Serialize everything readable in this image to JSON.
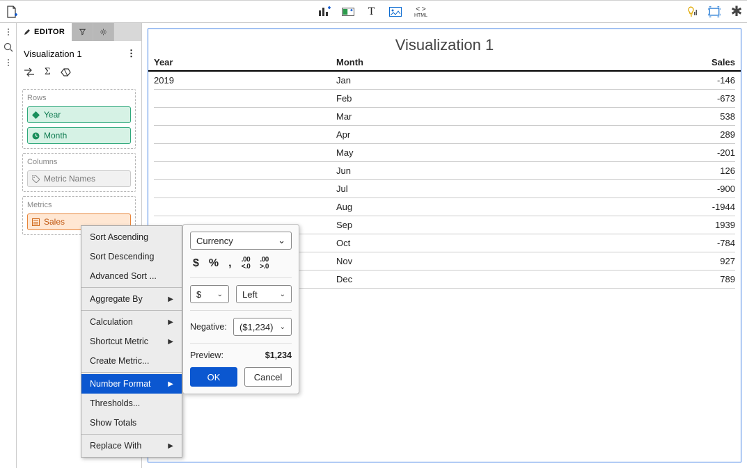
{
  "toolbar": {
    "new_page_icon": "new-page",
    "chart_add_icon": "chart-add",
    "container_icon": "container",
    "text_icon": "T",
    "image_icon": "image",
    "html_label": "HTML",
    "insight_icon": "lightbulb",
    "layout_icon": "layout"
  },
  "editor": {
    "tab_label": "EDITOR",
    "viz_name": "Visualization 1",
    "rows_label": "Rows",
    "columns_label": "Columns",
    "metrics_label": "Metrics",
    "pills": {
      "year": "Year",
      "month": "Month",
      "metric_names": "Metric Names",
      "sales": "Sales"
    }
  },
  "viz": {
    "title": "Visualization 1",
    "headers": {
      "year": "Year",
      "month": "Month",
      "sales": "Sales"
    },
    "rows": [
      {
        "year": "2019",
        "month": "Jan",
        "sales": "-146"
      },
      {
        "year": "",
        "month": "Feb",
        "sales": "-673"
      },
      {
        "year": "",
        "month": "Mar",
        "sales": "538"
      },
      {
        "year": "",
        "month": "Apr",
        "sales": "289"
      },
      {
        "year": "",
        "month": "May",
        "sales": "-201"
      },
      {
        "year": "",
        "month": "Jun",
        "sales": "126"
      },
      {
        "year": "",
        "month": "Jul",
        "sales": "-900"
      },
      {
        "year": "",
        "month": "Aug",
        "sales": "-1944"
      },
      {
        "year": "",
        "month": "Sep",
        "sales": "1939"
      },
      {
        "year": "",
        "month": "Oct",
        "sales": "-784"
      },
      {
        "year": "",
        "month": "Nov",
        "sales": "927"
      },
      {
        "year": "",
        "month": "Dec",
        "sales": "789"
      }
    ]
  },
  "ctx": {
    "sort_asc": "Sort Ascending",
    "sort_desc": "Sort Descending",
    "adv_sort": "Advanced Sort ...",
    "aggregate_by": "Aggregate By",
    "calculation": "Calculation",
    "shortcut_metric": "Shortcut Metric",
    "create_metric": "Create Metric...",
    "number_format": "Number Format",
    "thresholds": "Thresholds...",
    "show_totals": "Show Totals",
    "replace_with": "Replace With"
  },
  "fmt": {
    "type": "Currency",
    "symbol": "$",
    "position": "Left",
    "negative_label": "Negative:",
    "negative_value": "($1,234)",
    "preview_label": "Preview:",
    "preview_value": "$1,234",
    "ok": "OK",
    "cancel": "Cancel",
    "icons": {
      "dollar": "$",
      "percent": "%",
      "comma": ",",
      "dec_minus": ".00",
      "dec_plus": ".00"
    }
  }
}
